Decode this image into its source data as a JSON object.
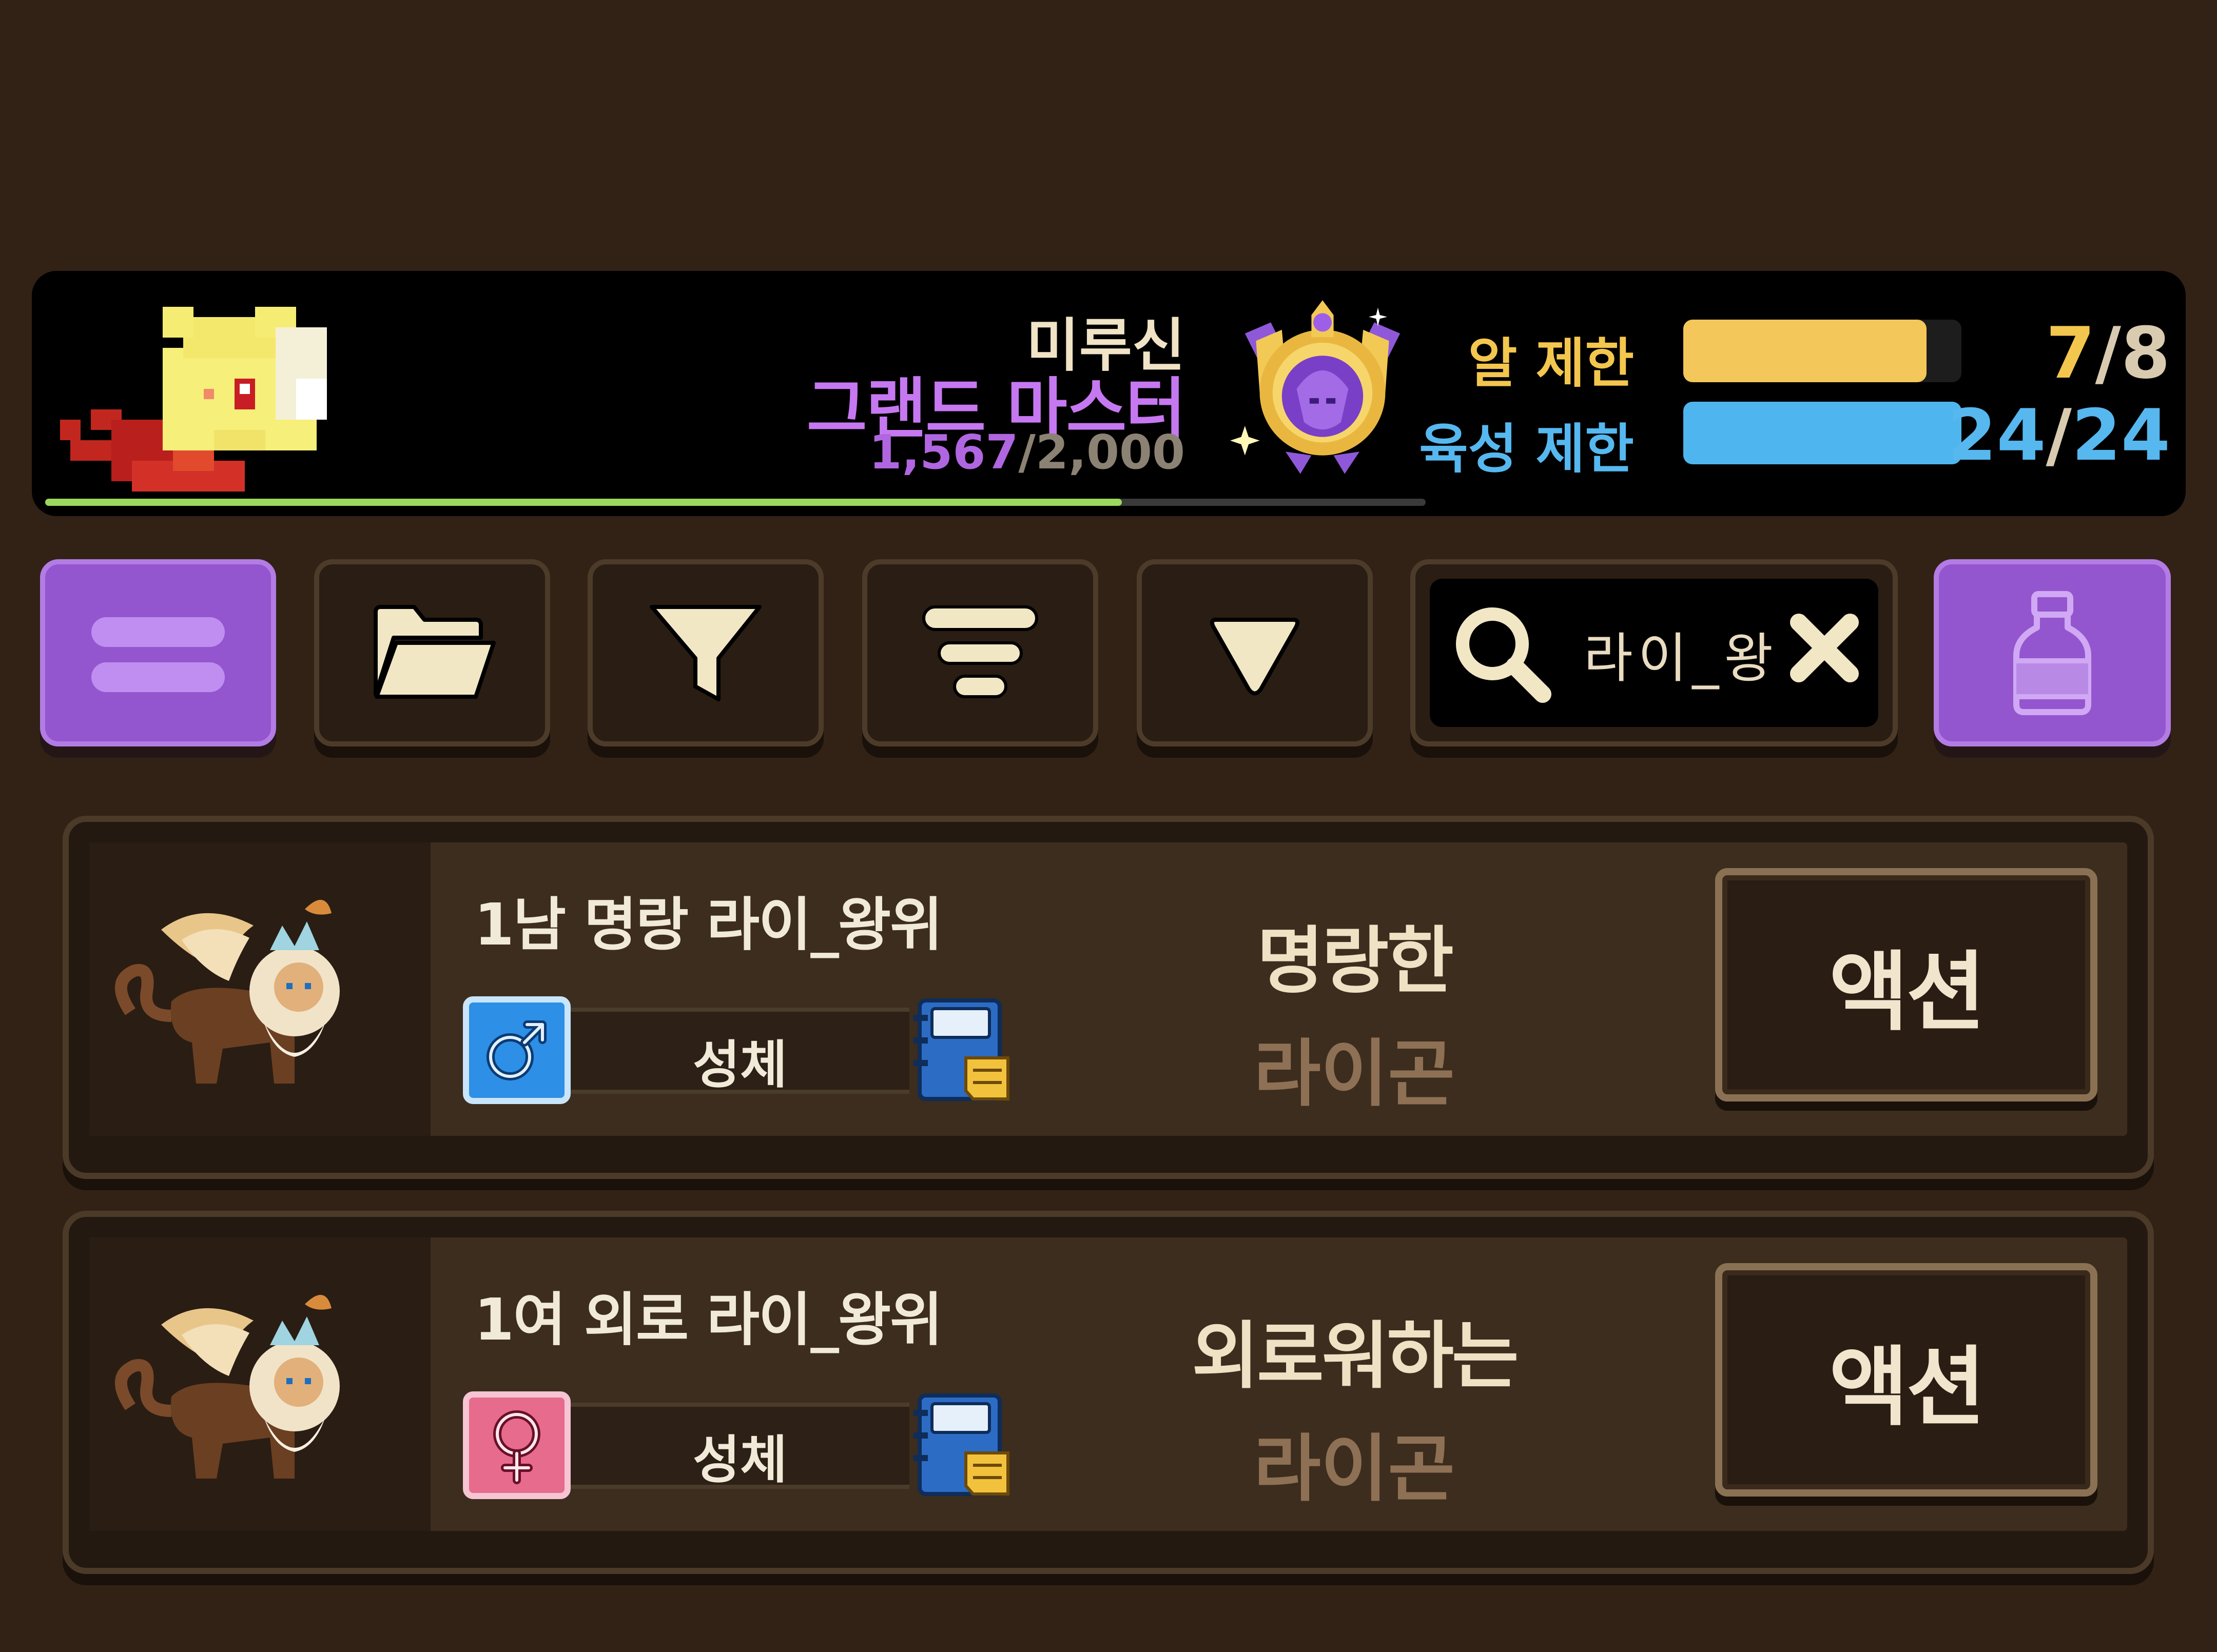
{
  "header": {
    "player_name": "미루신",
    "rank": "그랜드 마스터",
    "exp_current": "1,567",
    "exp_separator": "/",
    "exp_max": "2,000",
    "exp_progress": 0.78,
    "egg_limit_label": "알 제한",
    "egg_limit_current": "7",
    "egg_limit_max": "8",
    "egg_limit_progress": 0.875,
    "growth_limit_label": "육성 제한",
    "growth_limit_current": "24",
    "growth_limit_max": "24",
    "growth_limit_progress": 1.0,
    "slash": "/"
  },
  "toolbar": {
    "buttons": [
      "menu-icon",
      "folder-icon",
      "filter-icon",
      "sort-icon",
      "dropdown-triangle-icon",
      "search-icon",
      "potion-icon"
    ],
    "search_value": "라이_왕",
    "clear_icon": "close-icon"
  },
  "list": [
    {
      "name": "1남 명랑 라이_왕위",
      "gender": "male",
      "gender_icon": "male-icon",
      "stage": "성체",
      "trait": "명랑한",
      "species": "라이곤",
      "action_label": "액션"
    },
    {
      "name": "1여 외로 라이_왕위",
      "gender": "female",
      "gender_icon": "female-icon",
      "stage": "성체",
      "trait": "외로워하는",
      "species": "라이곤",
      "action_label": "액션"
    }
  ],
  "colors": {
    "background": "#322216",
    "rank": "#c678f0",
    "egg_limit": "#f3c64e",
    "growth_limit": "#56b8ef",
    "accent_purple": "#9356cf"
  }
}
